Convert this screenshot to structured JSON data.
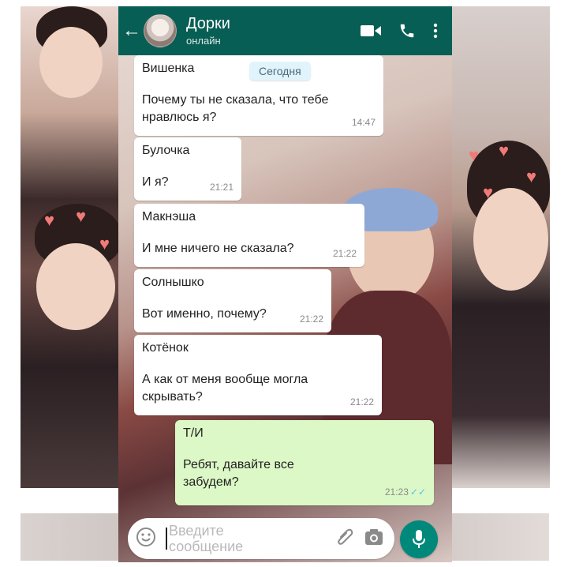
{
  "header": {
    "back_icon": "arrow-left-icon",
    "contact_name": "Дорки",
    "contact_status": "онлайн",
    "video_icon": "video-call-icon",
    "call_icon": "phone-icon",
    "menu_icon": "more-vertical-icon"
  },
  "date_label": "Сегодня",
  "messages": [
    {
      "sender": "Вишенка",
      "text": "Почему ты не сказала, что тебе нравлюсь я?",
      "time": "14:47",
      "outgoing": false
    },
    {
      "sender": "Булочка",
      "text": "И я?",
      "time": "21:21",
      "outgoing": false
    },
    {
      "sender": "Макнэша",
      "text": "И мне ничего не сказала?",
      "time": "21:22",
      "outgoing": false
    },
    {
      "sender": "Солнышко",
      "text": "Вот именно, почему?",
      "time": "21:22",
      "outgoing": false
    },
    {
      "sender": "Котёнок",
      "text": "А как от меня вообще могла скрывать?",
      "time": "21:22",
      "outgoing": false
    },
    {
      "sender": "Т/И",
      "text": "Ребят, давайте все забудем?",
      "time": "21:23",
      "outgoing": true,
      "status": "read"
    }
  ],
  "input": {
    "placeholder": "Введите сообщение",
    "emoji_icon": "emoji-icon",
    "attach_icon": "paperclip-icon",
    "camera_icon": "camera-icon",
    "mic_icon": "microphone-icon"
  },
  "colors": {
    "header": "#075e54",
    "outgoing_bubble": "#dcf8c6",
    "incoming_bubble": "#ffffff",
    "date_pill": "#e1f3fb",
    "mic_button": "#00897b",
    "read_ticks": "#4fc3f7"
  }
}
